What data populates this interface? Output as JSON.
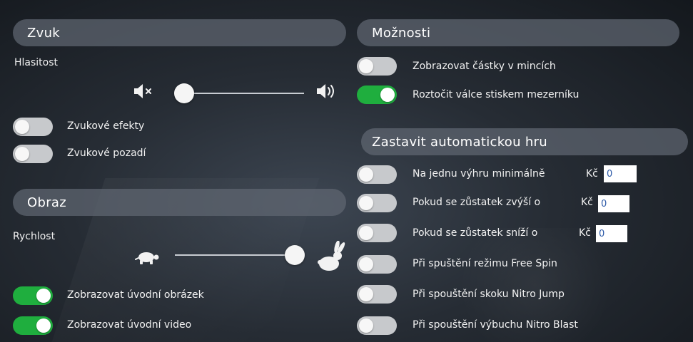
{
  "sound": {
    "header": "Zvuk",
    "volume_label": "Hlasitost",
    "volume_level": 0.0,
    "effects_label": "Zvukové efekty",
    "effects_on": false,
    "background_label": "Zvukové pozadí",
    "background_on": false
  },
  "image": {
    "header": "Obraz",
    "speed_label": "Rychlost",
    "speed_level": 1.0,
    "intro_image_label": "Zobrazovat úvodní obrázek",
    "intro_image_on": true,
    "intro_video_label": "Zobrazovat úvodní video",
    "intro_video_on": true
  },
  "options": {
    "header": "Možnosti",
    "coins_label": "Zobrazovat částky v mincích",
    "coins_on": false,
    "spacebar_label": "Roztočit válce stiskem mezerníku",
    "spacebar_on": true
  },
  "autoplay": {
    "header": "Zastavit automatickou hru",
    "currency": "Kč",
    "rows": [
      {
        "label": "Na jednu výhru minimálně",
        "on": false,
        "has_input": true,
        "value": "0"
      },
      {
        "label": "Pokud se zůstatek zvýší o",
        "on": false,
        "has_input": true,
        "value": "0"
      },
      {
        "label": "Pokud se zůstatek sníží o",
        "on": false,
        "has_input": true,
        "value": "0"
      },
      {
        "label": "Při spuštění režimu Free Spin",
        "on": false,
        "has_input": false
      },
      {
        "label": "Při spouštění skoku Nitro Jump",
        "on": false,
        "has_input": false
      },
      {
        "label": "Při spouštění výbuchu Nitro Blast",
        "on": false,
        "has_input": false
      }
    ]
  },
  "icons": {
    "mute": "speaker-mute-icon",
    "volume": "speaker-volume-icon",
    "slow": "turtle-icon",
    "fast": "rabbit-icon"
  },
  "colors": {
    "toggle_on": "#1fae3e",
    "toggle_off": "#c7c9cc",
    "header_bg": "#5f6772",
    "input_text": "#2d5aa8"
  }
}
